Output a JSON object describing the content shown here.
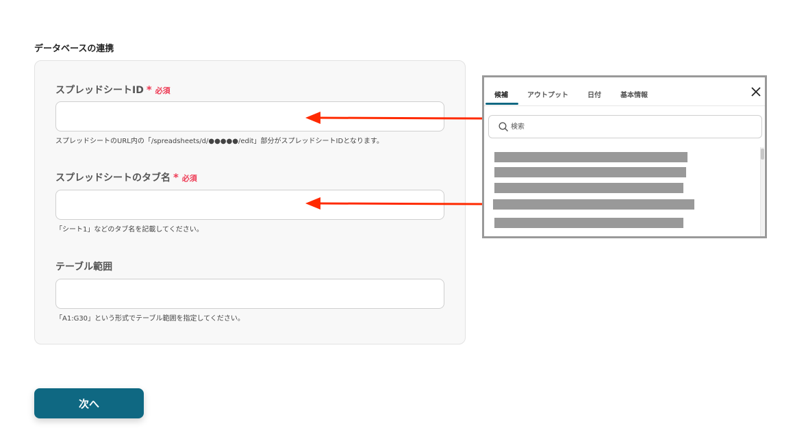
{
  "section_title": "データベースの連携",
  "required_label": "必須",
  "required_star": "*",
  "fields": [
    {
      "label": "スプレッドシートID",
      "required": true,
      "value": "",
      "help": "スプレッドシートのURL内の「/spreadsheets/d/●●●●●/edit」部分がスプレッドシートIDとなります。"
    },
    {
      "label": "スプレッドシートのタブ名",
      "required": true,
      "value": "",
      "help": "「シート1」などのタブ名を記載してください。"
    },
    {
      "label": "テーブル範囲",
      "required": false,
      "value": "",
      "help": "「A1:G30」という形式でテーブル範囲を指定してください。"
    }
  ],
  "next_button": "次へ",
  "popup": {
    "tabs": [
      "候補",
      "アウトプット",
      "日付",
      "基本情報"
    ],
    "active_tab": "候補",
    "search_placeholder": "検索",
    "redacted_item_count": 5,
    "close_icon": "close-icon",
    "search_icon": "search-icon"
  },
  "colors": {
    "accent": "#0f6882",
    "required": "#ee3b55",
    "arrow": "#ff2a00",
    "redacted": "#999999"
  }
}
